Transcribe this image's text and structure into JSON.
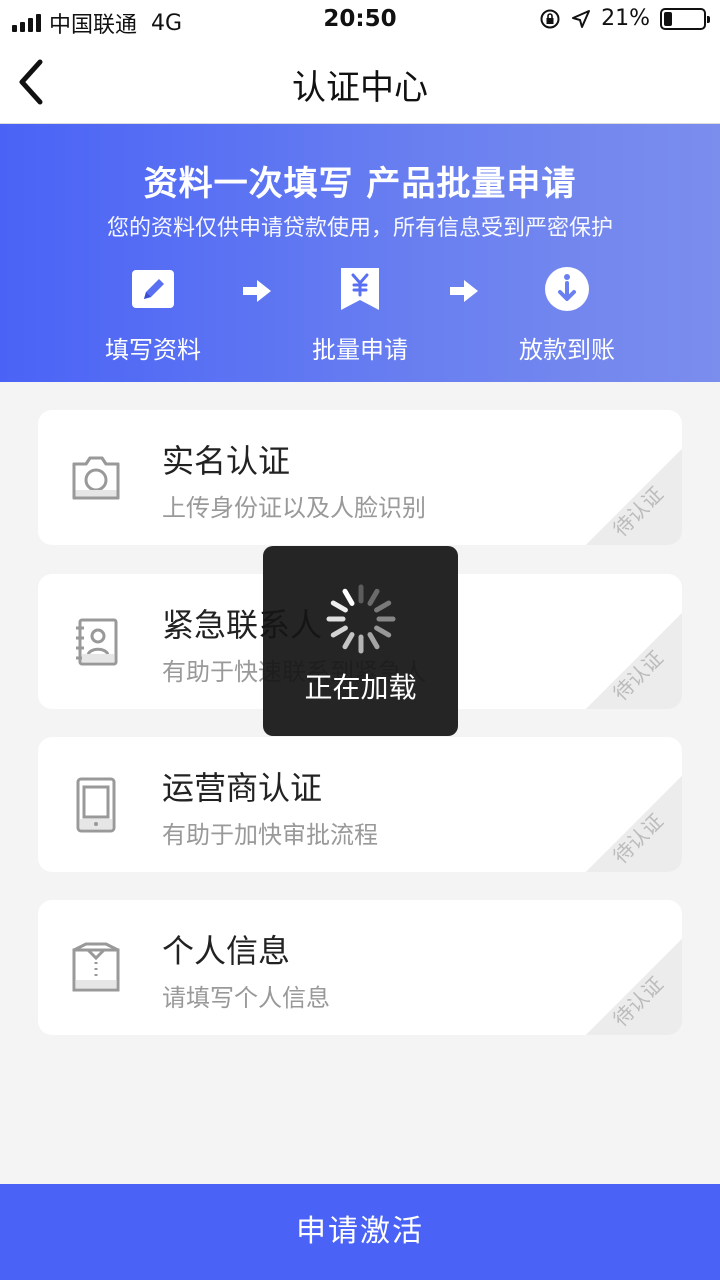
{
  "status_bar": {
    "carrier": "中国联通",
    "network": "4G",
    "time": "20:50",
    "battery": "21%",
    "battery_level": 0.21
  },
  "nav": {
    "title": "认证中心",
    "back_icon": "chevron-left-icon"
  },
  "banner": {
    "title": "资料一次填写 产品批量申请",
    "subtitle": "您的资料仅供申请贷款使用，所有信息受到严密保护",
    "steps": [
      {
        "label": "填写资料",
        "icon": "pencil-icon"
      },
      {
        "label": "批量申请",
        "icon": "yen-bookmark-icon"
      },
      {
        "label": "放款到账",
        "icon": "download-circle-icon"
      }
    ]
  },
  "cards": [
    {
      "title": "实名认证",
      "desc": "上传身份证以及人脸识别",
      "status": "待认证",
      "icon": "camera-icon"
    },
    {
      "title": "紧急联系人",
      "desc": "有助于快速联系到紧急人",
      "status": "待认证",
      "icon": "contact-book-icon"
    },
    {
      "title": "运营商认证",
      "desc": "有助于加快审批流程",
      "status": "待认证",
      "icon": "phone-icon"
    },
    {
      "title": "个人信息",
      "desc": "请填写个人信息",
      "status": "待认证",
      "icon": "id-card-icon"
    }
  ],
  "loading": {
    "text": "正在加载"
  },
  "footer": {
    "button_label": "申请激活"
  },
  "colors": {
    "accent": "#4a63f6",
    "banner_gradient_end": "#7b8ded"
  }
}
